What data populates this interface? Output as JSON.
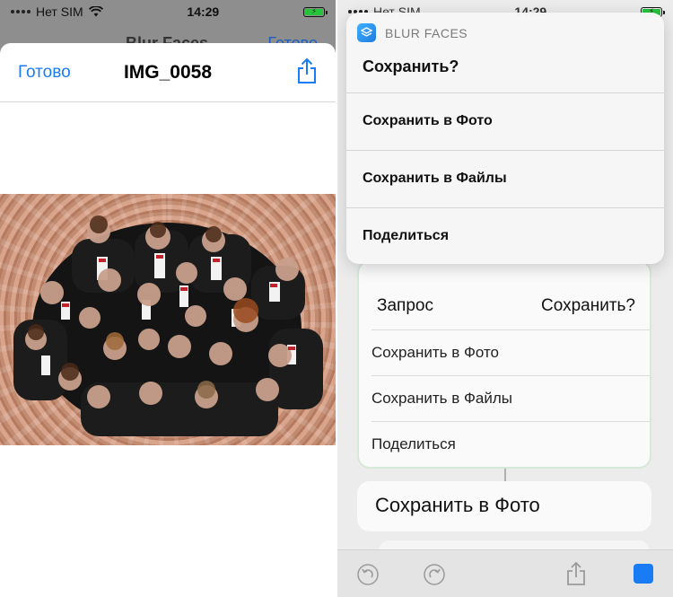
{
  "left": {
    "status": {
      "carrier": "Нет SIM",
      "time": "14:29"
    },
    "behind_nav": {
      "title": "Blur Faces",
      "done": "Готово"
    },
    "sheet": {
      "done_label": "Готово",
      "title": "IMG_0058"
    }
  },
  "right": {
    "status": {
      "carrier": "Нет SIM",
      "time": "14:29"
    },
    "popup": {
      "app_name": "BLUR FACES",
      "question": "Сохранить?",
      "options": [
        "Сохранить в Фото",
        "Сохранить в Файлы",
        "Поделиться"
      ]
    },
    "bg_card": {
      "request_label": "Запрос",
      "request_value": "Сохранить?",
      "items": [
        "Сохранить в Фото",
        "Сохранить в Файлы",
        "Поделиться"
      ]
    },
    "action_card_label": "Сохранить в Фото"
  },
  "colors": {
    "accent": "#1a7cf5",
    "battery": "#27c23c"
  },
  "icons": [
    "share-icon",
    "wifi-icon",
    "battery-icon",
    "undo-icon",
    "redo-icon",
    "stop-icon",
    "shortcuts-app-icon"
  ]
}
